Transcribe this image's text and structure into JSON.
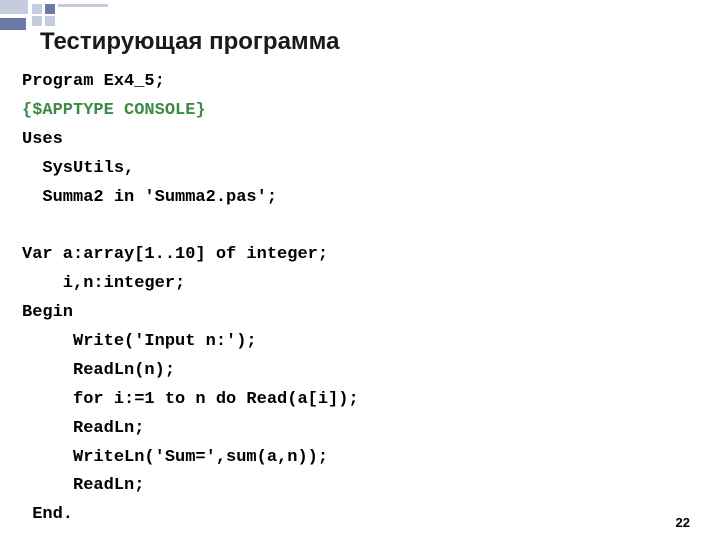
{
  "heading": "Тестирующая программа",
  "code": {
    "line1": "Program Ex4_5;",
    "line2": "{$APPTYPE CONSOLE}",
    "line3": "Uses",
    "line4": "  SysUtils,",
    "line5": "  Summa2 in 'Summa2.pas';",
    "line6": "",
    "line7": "Var a:array[1..10] of integer;",
    "line8": "    i,n:integer;",
    "line9": "Begin",
    "line10": "     Write('Input n:');",
    "line11": "     ReadLn(n);",
    "line12": "     for i:=1 to n do Read(a[i]);",
    "line13": "     ReadLn;",
    "line14": "     WriteLn('Sum=',sum(a,n));",
    "line15": "     ReadLn;",
    "line16": " End."
  },
  "page_number": "22"
}
